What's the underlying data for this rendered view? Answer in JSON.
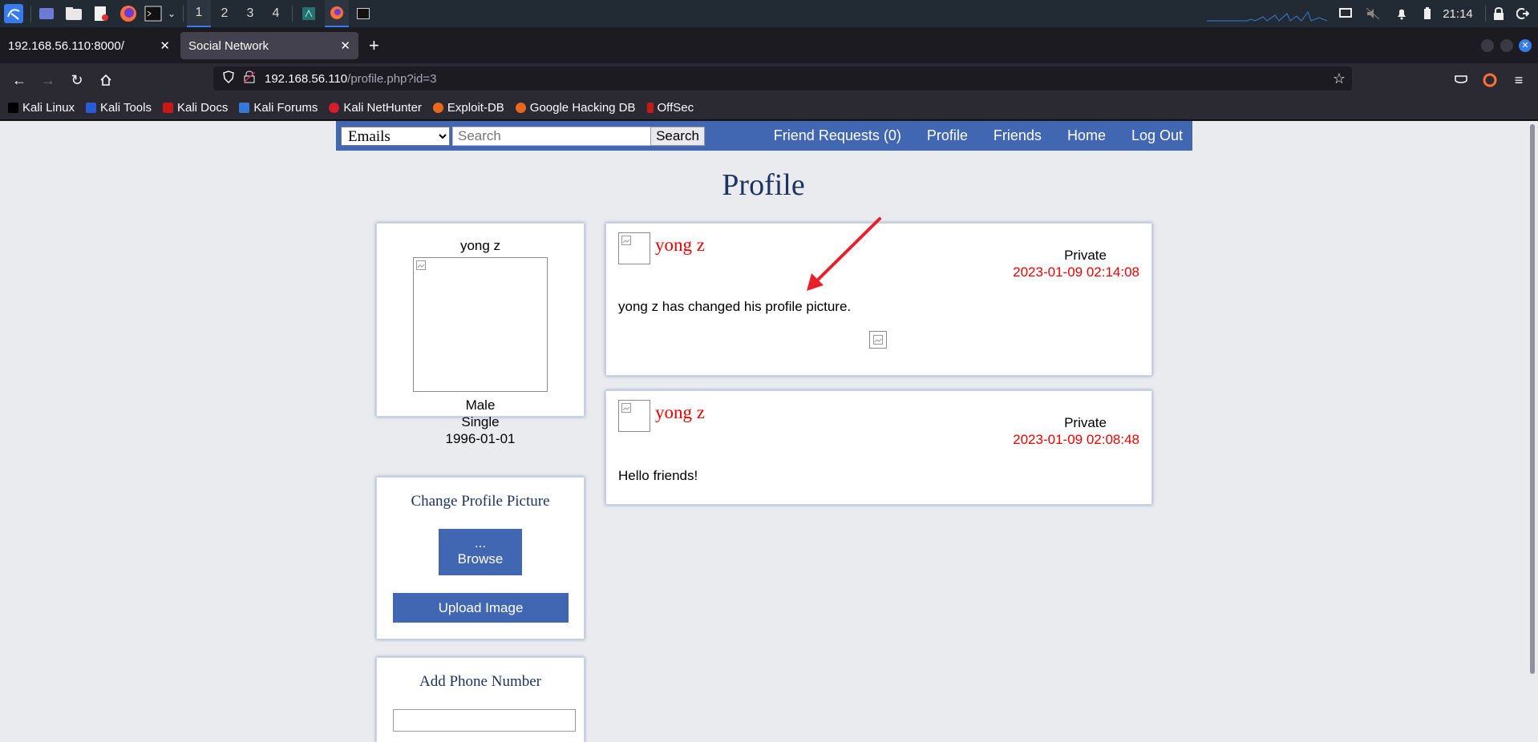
{
  "taskbar": {
    "workspaces": [
      "1",
      "2",
      "3",
      "4"
    ],
    "clock": "21:14"
  },
  "browser": {
    "tabs": [
      {
        "title": "192.168.56.110:8000/"
      },
      {
        "title": "Social Network"
      }
    ],
    "url_host": "192.168.56.110",
    "url_path": "/profile.php?id=3",
    "bookmarks": [
      "Kali Linux",
      "Kali Tools",
      "Kali Docs",
      "Kali Forums",
      "Kali NetHunter",
      "Exploit-DB",
      "Google Hacking DB",
      "OffSec"
    ]
  },
  "sitenav": {
    "select_value": "Emails",
    "search_placeholder": "Search",
    "search_button": "Search",
    "links": [
      "Friend Requests (0)",
      "Profile",
      "Friends",
      "Home",
      "Log Out"
    ]
  },
  "page": {
    "title": "Profile"
  },
  "profile": {
    "name": "yong z",
    "gender": "Male",
    "status": "Single",
    "birthday": "1996-01-01"
  },
  "change_picture": {
    "heading": "Change Profile Picture",
    "browse_dots": "...",
    "browse_label": "Browse",
    "upload_label": "Upload Image"
  },
  "phone": {
    "heading": "Add Phone Number"
  },
  "posts": [
    {
      "author": "yong z",
      "privacy": "Private",
      "date": "2023-01-09 02:14:08",
      "text": "yong z has changed his profile picture."
    },
    {
      "author": "yong z",
      "privacy": "Private",
      "date": "2023-01-09 02:08:48",
      "text": "Hello friends!"
    }
  ],
  "colors": {
    "brand": "#4267b2",
    "accent_red": "#ee0000",
    "heading": "#1d3461",
    "page_bg": "#e9ebee"
  }
}
